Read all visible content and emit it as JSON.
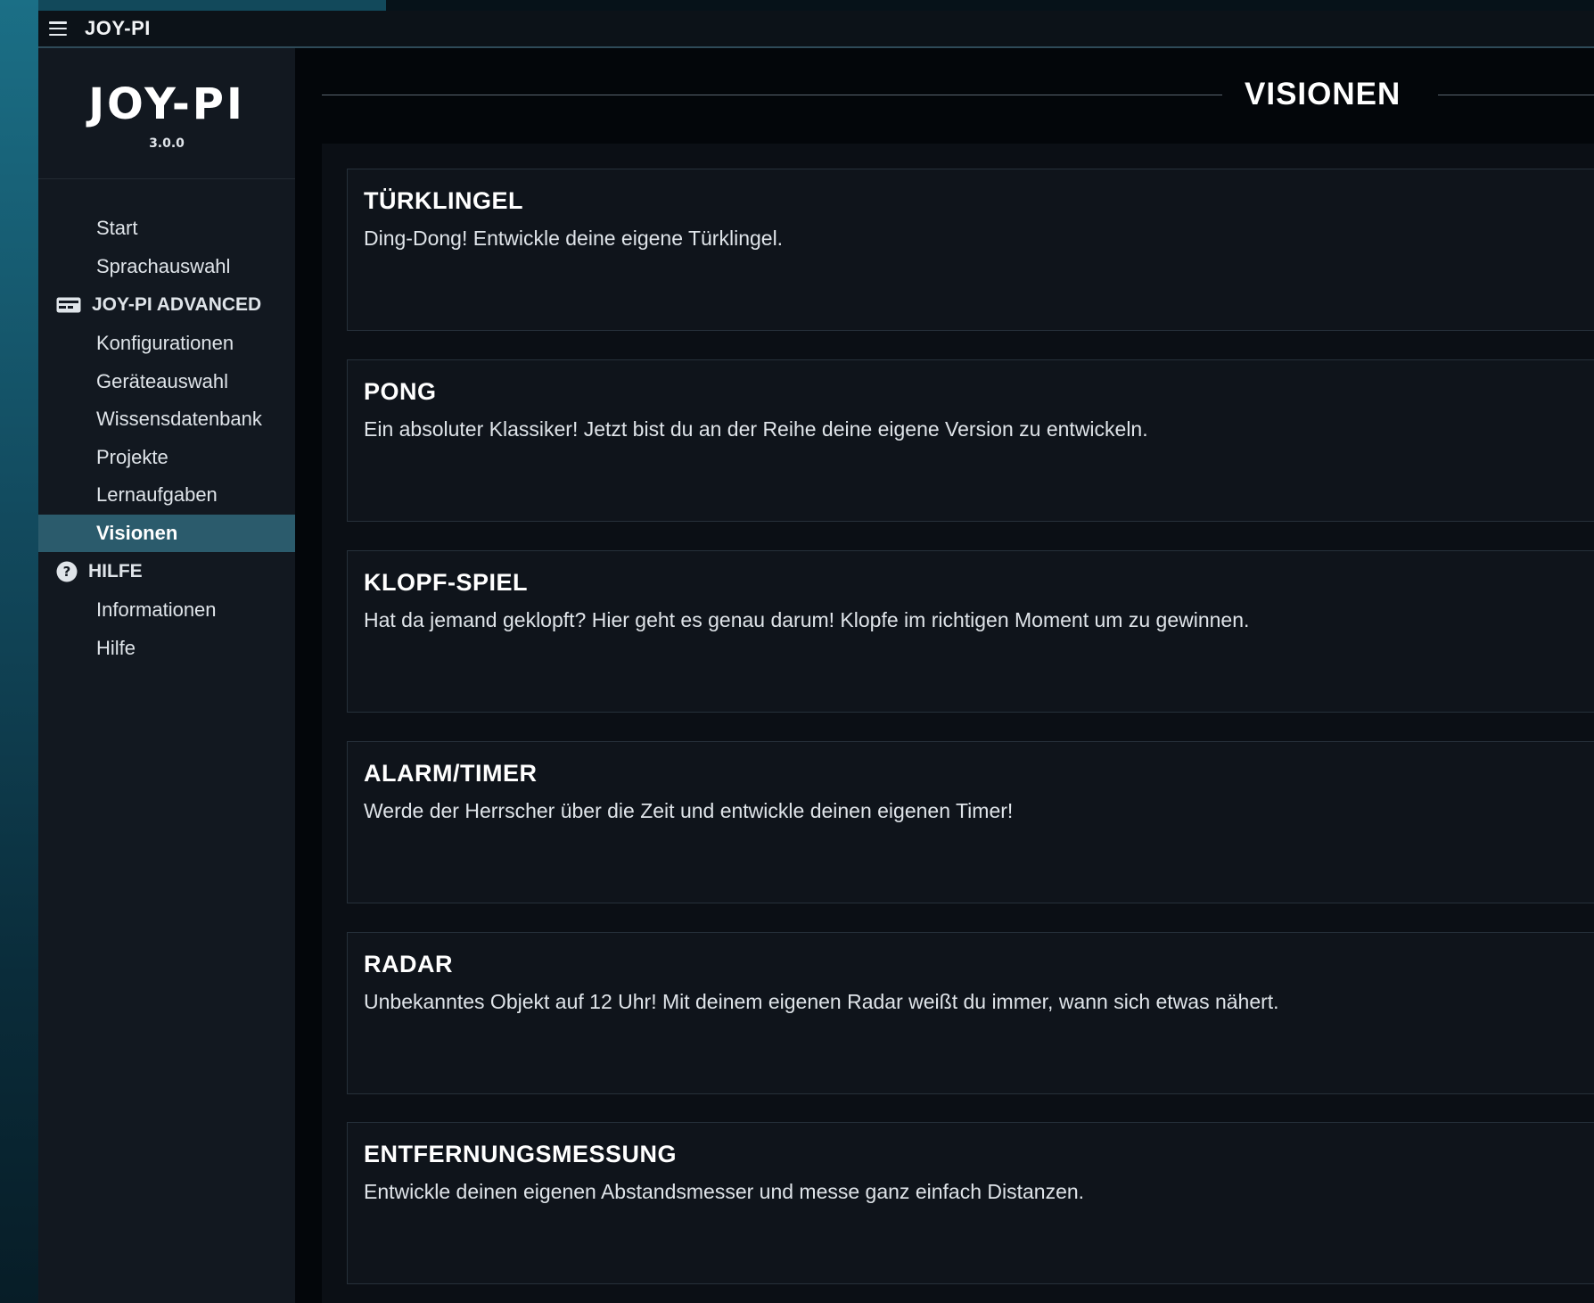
{
  "window": {
    "title": "JOY-PI"
  },
  "sidebar": {
    "logo": "JOY-PI",
    "version": "3.0.0",
    "items_top": [
      {
        "label": "Start"
      },
      {
        "label": "Sprachauswahl"
      }
    ],
    "section_advanced": "JOY-PI ADVANCED",
    "items_advanced": [
      {
        "label": "Konfigurationen"
      },
      {
        "label": "Geräteauswahl"
      },
      {
        "label": "Wissensdatenbank"
      },
      {
        "label": "Projekte"
      },
      {
        "label": "Lernaufgaben"
      },
      {
        "label": "Visionen"
      }
    ],
    "section_help": "HILFE",
    "items_help": [
      {
        "label": "Informationen"
      },
      {
        "label": "Hilfe"
      }
    ],
    "active_item": "Visionen"
  },
  "main": {
    "page_title": "VISIONEN",
    "cards": [
      {
        "title": "TÜRKLINGEL",
        "description": "Ding-Dong! Entwickle deine eigene Türklingel."
      },
      {
        "title": "PONG",
        "description": "Ein absoluter Klassiker! Jetzt bist du an der Reihe deine eigene Version zu entwickeln."
      },
      {
        "title": "KLOPF-SPIEL",
        "description": "Hat da jemand geklopft? Hier geht es genau darum! Klopfe im richtigen Moment um zu gewinnen."
      },
      {
        "title": "ALARM/TIMER",
        "description": "Werde der Herrscher über die Zeit und entwickle deinen eigenen Timer!"
      },
      {
        "title": "RADAR",
        "description": "Unbekanntes Objekt auf 12 Uhr! Mit deinem eigenen Radar weißt du immer, wann sich etwas nähert."
      },
      {
        "title": "ENTFERNUNGSMESSUNG",
        "description": "Entwickle deinen eigenen Abstandsmesser und messe ganz einfach Distanzen."
      }
    ]
  },
  "colors": {
    "accent": "#2b5b6c",
    "sidebar_bg": "#121820",
    "card_bg": "#0f141b"
  },
  "icons": {
    "menu": "hamburger-icon",
    "advanced": "card-icon",
    "help": "question-circle-icon"
  }
}
